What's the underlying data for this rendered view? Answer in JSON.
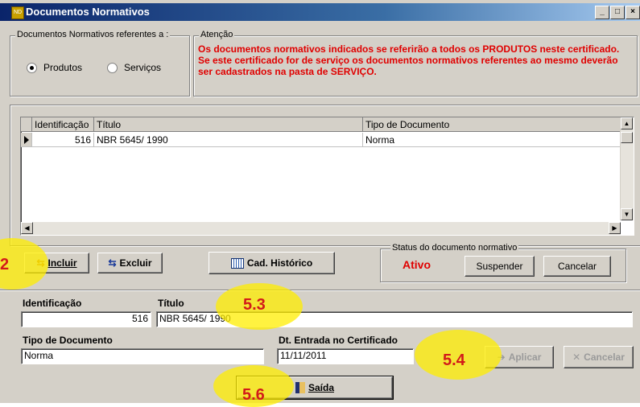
{
  "window": {
    "title": "Documentos Normativos",
    "icon": "app-icon",
    "title_buttons": [
      "_",
      "□",
      "×"
    ]
  },
  "scope": {
    "label": "Documentos Normativos referentes a :",
    "options": [
      {
        "label": "Produtos",
        "selected": true
      },
      {
        "label": "Serviços",
        "selected": false
      }
    ]
  },
  "attention": {
    "label": "Atenção",
    "message": "Os documentos normativos indicados se referirão a todos os PRODUTOS neste certificado. Se este certificado for de serviço os documentos normativos referentes ao mesmo deverão ser cadastrados na pasta de SERVIÇO.",
    "color": "#e00000"
  },
  "grid": {
    "columns": [
      "Identificação",
      "Título",
      "Tipo de Documento"
    ],
    "rows": [
      {
        "id": "516",
        "titulo": "NBR 5645/ 1990",
        "tipo": "Norma"
      }
    ]
  },
  "actions": {
    "incluir": "Incluir",
    "excluir": "Excluir",
    "historico": "Cad. Histórico"
  },
  "status": {
    "label": "Status do documento normativo",
    "value": "Ativo",
    "suspend": "Suspender",
    "cancel": "Cancelar"
  },
  "form": {
    "id_label": "Identificação",
    "id_value": "516",
    "titulo_label": "Título",
    "titulo_value": "NBR 5645/ 1990",
    "tipo_label": "Tipo de Documento",
    "tipo_value": "Norma",
    "data_label": "Dt. Entrada no Certificado",
    "data_value": "11/11/2011",
    "aplicar": "Aplicar",
    "cancelar": "Cancelar"
  },
  "exit": {
    "label": "Saída"
  },
  "annotations": [
    "2",
    "5.3",
    "5.4",
    "5.6"
  ]
}
